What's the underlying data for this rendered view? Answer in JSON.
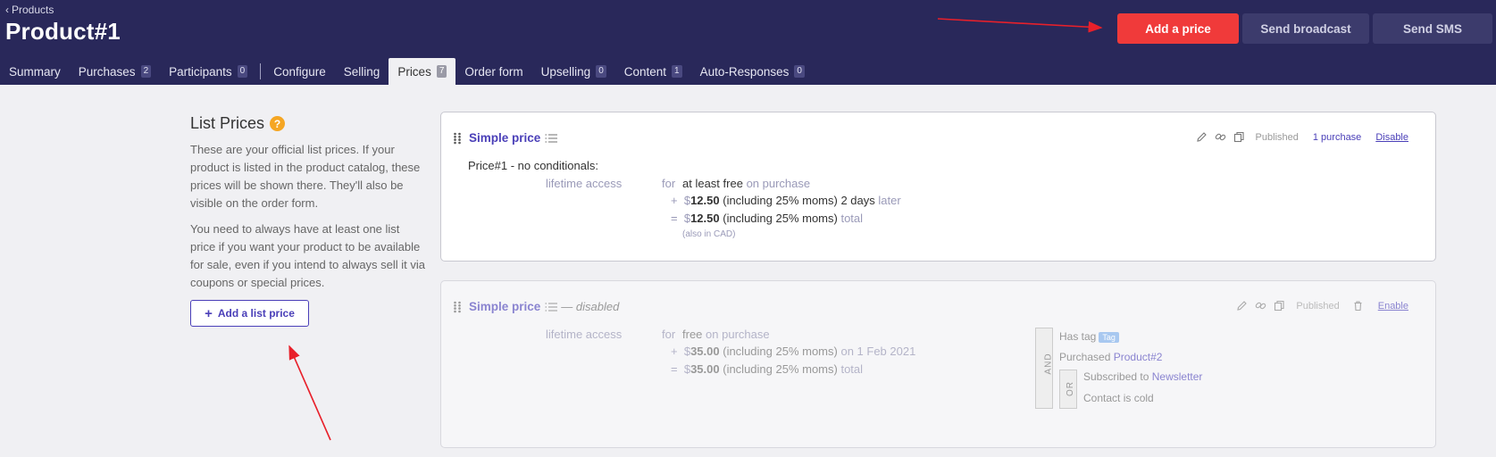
{
  "header": {
    "breadcrumb": "Products",
    "title": "Product#1",
    "buttons": {
      "add_price": "Add a price",
      "send_broadcast": "Send broadcast",
      "send_sms": "Send SMS"
    }
  },
  "tabs": [
    {
      "label": "Summary",
      "count": ""
    },
    {
      "label": "Purchases",
      "count": "2"
    },
    {
      "label": "Participants",
      "count": "0"
    },
    {
      "label": "Configure",
      "count": ""
    },
    {
      "label": "Selling",
      "count": ""
    },
    {
      "label": "Prices",
      "count": "7"
    },
    {
      "label": "Order form",
      "count": ""
    },
    {
      "label": "Upselling",
      "count": "0"
    },
    {
      "label": "Content",
      "count": "1"
    },
    {
      "label": "Auto-Responses",
      "count": "0"
    }
  ],
  "active_tab": "Prices",
  "list_prices": {
    "title": "List Prices",
    "help_glyph": "?",
    "para1": "These are your official list prices. If your product is listed in the product catalog, these prices will be shown there. They'll also be visible on the order form.",
    "para2": "You need to always have at least one list price if you want your product to be available for sale, even if you intend to always sell it via coupons or special prices.",
    "add_button": "Add a list price"
  },
  "cards": [
    {
      "name": "Simple price",
      "disabled_label": "",
      "status": "Published",
      "purchases": "1 purchase",
      "action": "Disable",
      "conditional": "Price#1 - no conditionals:",
      "access": "lifetime access",
      "for": "for",
      "base_amount": "at least free",
      "base_when": "on purchase",
      "plus_sign": "+",
      "eq_sign": "=",
      "currency": "$",
      "line2_amount": "12.50",
      "line2_desc": "(including 25% moms) 2 days",
      "line2_suffix": "later",
      "line3_amount": "12.50",
      "line3_desc": "(including 25% moms)",
      "line3_suffix": "total",
      "note": "(also in CAD)"
    },
    {
      "name": "Simple price",
      "disabled_label": "— disabled",
      "status": "Published",
      "action": "Enable",
      "access": "lifetime access",
      "for": "for",
      "base_amount": "free",
      "base_when": "on purchase",
      "plus_sign": "+",
      "eq_sign": "=",
      "currency": "$",
      "line2_amount": "35.00",
      "line2_desc": "(including 25% moms)",
      "line2_suffix": "on 1 Feb 2021",
      "line3_amount": "35.00",
      "line3_desc": "(including 25% moms)",
      "line3_suffix": "total",
      "conditions": {
        "and_label": "AND",
        "or_label": "OR",
        "has_tag": "Has tag",
        "tag": "Tag",
        "purchased": "Purchased",
        "purchased_link": "Product#2",
        "subscribed": "Subscribed to",
        "subscribed_link": "Newsletter",
        "contact": "Contact is cold"
      }
    }
  ],
  "colors": {
    "header_bg": "#29285a",
    "accent_red": "#f03a3a",
    "link_purple": "#4a3fb8",
    "help_orange": "#f5a623",
    "annotation_arrow": "#e8202a"
  }
}
